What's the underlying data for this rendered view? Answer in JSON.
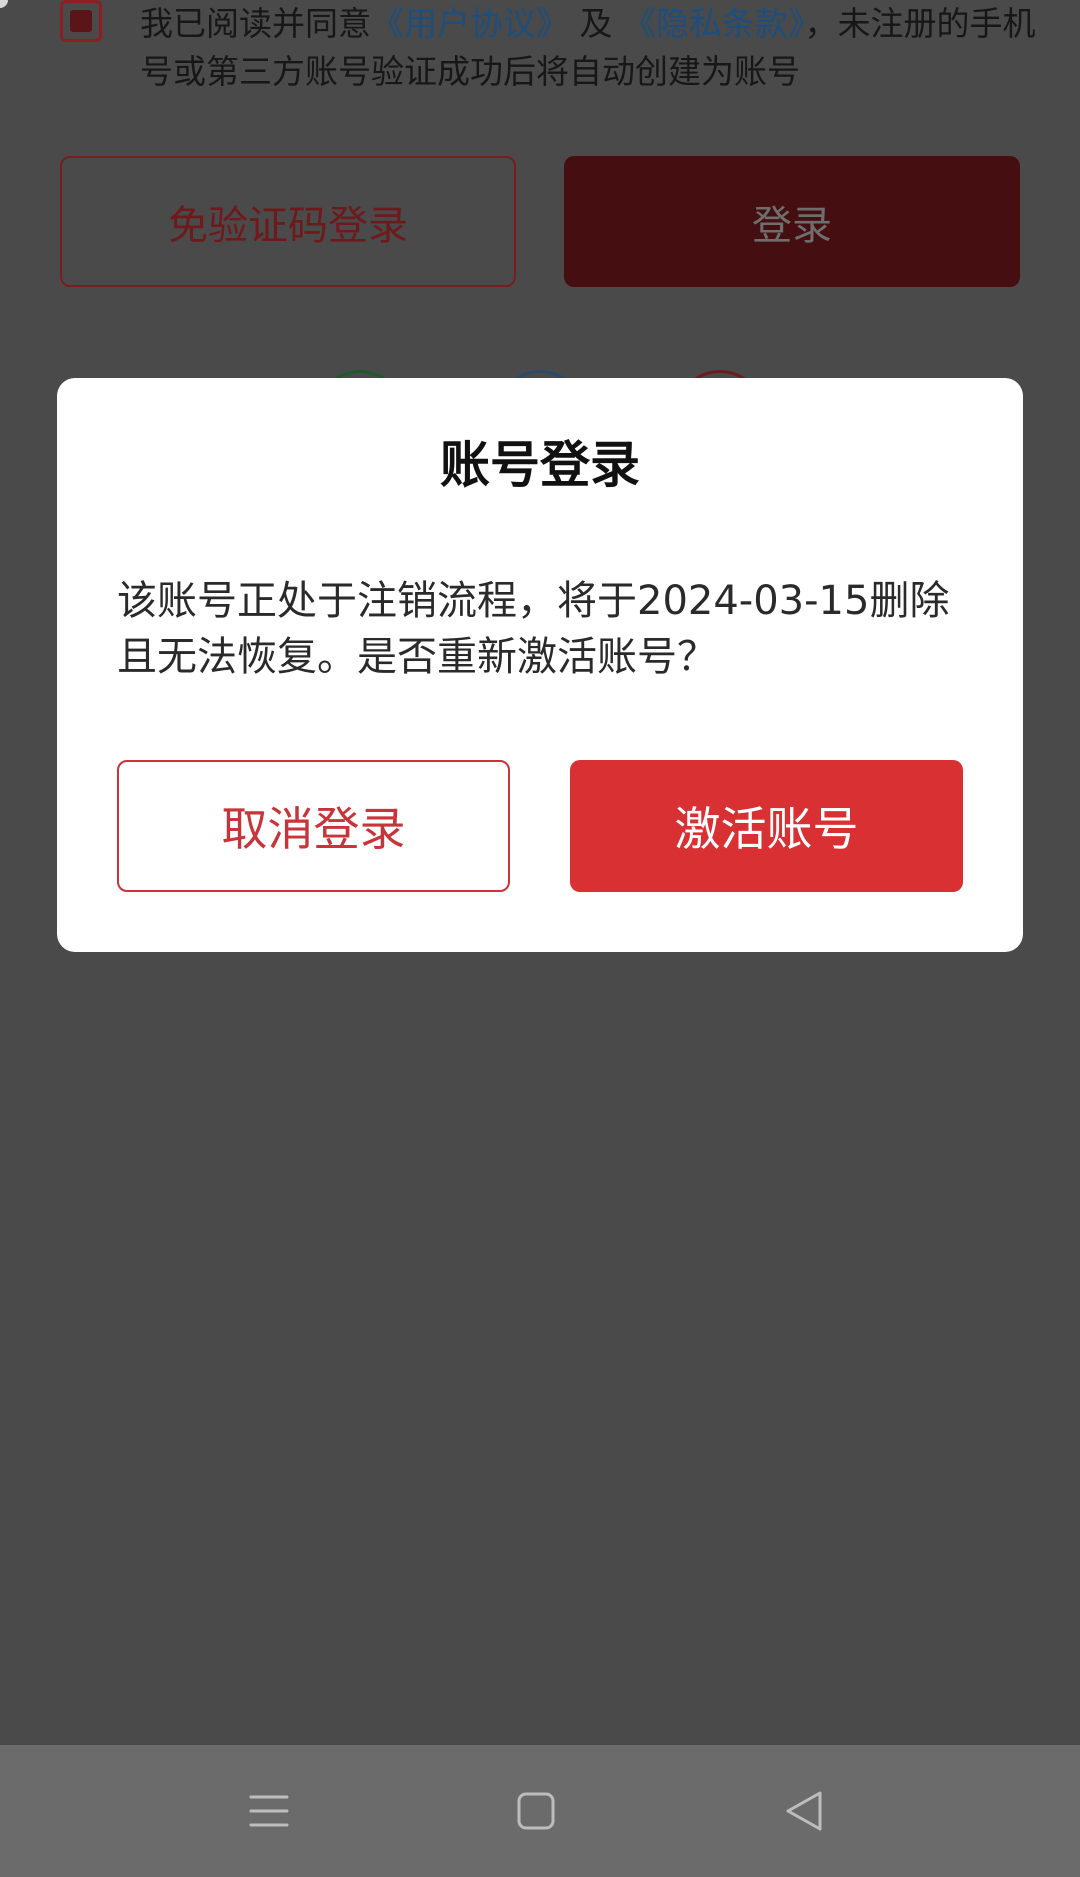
{
  "agreement": {
    "prefix": "我已阅读并同意",
    "user_agreement_link": "《用户协议》",
    "conjunction": " 及 ",
    "privacy_link": "《隐私条款》",
    "suffix": "，未注册的手机号或第三方账号验证成功后将自动创建为账号",
    "checked": true
  },
  "background": {
    "passwordless_button": "免验证码登录",
    "login_button": "登录",
    "third_party_icons": [
      "wechat-icon",
      "qq-icon",
      "weibo-icon"
    ]
  },
  "dialog": {
    "title": "账号登录",
    "message": "该账号正处于注销流程，将于2024-03-15删除且无法恢复。是否重新激活账号？",
    "cancel_label": "取消登录",
    "confirm_label": "激活账号"
  },
  "nav_bar": {
    "icons": [
      "menu-icon",
      "home-icon",
      "back-icon"
    ]
  },
  "colors": {
    "accent": "#d93033",
    "link": "#1d4e7e",
    "overlay": "#4a4a4a",
    "nav_bar": "#6b6b6b"
  }
}
